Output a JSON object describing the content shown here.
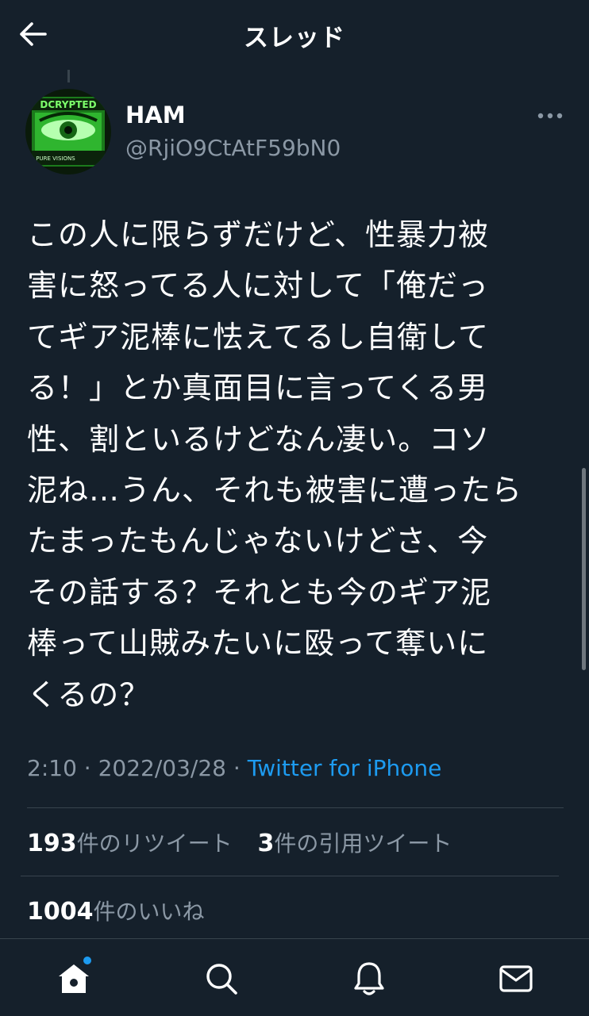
{
  "header": {
    "title": "スレッド",
    "back_icon": "arrow-left-icon"
  },
  "tweet": {
    "avatar": {
      "brand_text": "DCRYPTED",
      "sub_text": "PURE VISIONS",
      "color": "#3ddc3d"
    },
    "display_name": "HAM",
    "handle": "@RjiO9CtAtF59bN0",
    "text": "この人に限らずだけど、性暴力被\n害に怒ってる人に対して「俺だっ\nてギア泥棒に怯えてるし自衛して\nる！」とか真面目に言ってくる男\n性、割といるけどなん凄い。コソ\n泥ね…うん、それも被害に遭ったら\nたまったもんじゃないけどさ、今\nその話する？それとも今のギア泥\n棒って山賊みたいに殴って奪いに\nくるの？",
    "time": "2:10",
    "date": "2022/03/28",
    "separator": "·",
    "source": "Twitter for iPhone"
  },
  "stats": {
    "retweets_count": "193",
    "retweets_label": "件のリツイート",
    "quotes_count": "3",
    "quotes_label": "件の引用ツイート",
    "likes_count": "1004",
    "likes_label": "件のいいね"
  },
  "nav": {
    "items": [
      "home-icon",
      "search-icon",
      "bell-icon",
      "mail-icon"
    ],
    "accent": "#1d9bf0"
  },
  "colors": {
    "background": "#15202b",
    "secondary_text": "#8b98a5",
    "divider": "#38444d",
    "link": "#1d9bf0"
  }
}
